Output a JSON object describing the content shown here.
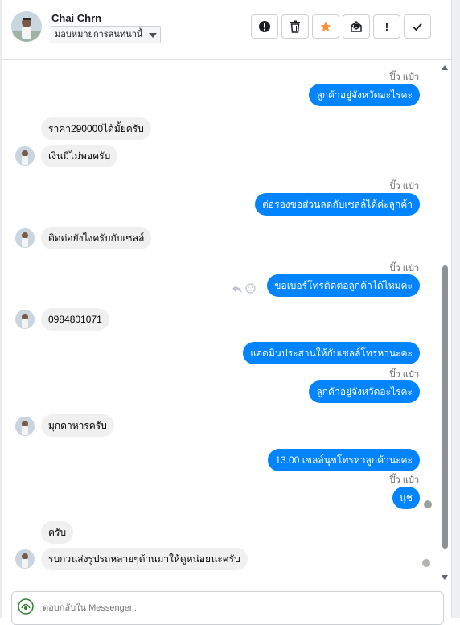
{
  "header": {
    "user_name": "Chai Chrn",
    "assign_label": "มอบหมายการสนทนานี้",
    "toolbar": {
      "exclamation_label": "!"
    }
  },
  "conversation": {
    "messages": [
      {
        "id": "m1",
        "direction": "out",
        "sender": "ปิ๊ว แป๋ว",
        "text": "ลูกค้าอยู่จังหวัดอะไรคะ"
      },
      {
        "id": "m2",
        "direction": "in",
        "text": "ราคา290000ได้มั้ยครับ"
      },
      {
        "id": "m3",
        "direction": "in",
        "text": "เงินมีไม่พอครับ"
      },
      {
        "id": "m4",
        "direction": "out",
        "sender": "ปิ๊ว แป๋ว",
        "text": "ต่อรองขอส่วนลดกับเซลล์ได้ค่ะลูกค้า"
      },
      {
        "id": "m5",
        "direction": "in",
        "text": "ติดต่อยังไงครับกับเซลล์"
      },
      {
        "id": "m6",
        "direction": "out",
        "sender": "ปิ๊ว แป๋ว",
        "text": "ขอเบอร์โทรติดต่อลูกค้าได้ไหมคะ"
      },
      {
        "id": "m7",
        "direction": "in",
        "text": "0984801071"
      },
      {
        "id": "m8",
        "direction": "out",
        "text": "แอดมินประสานให้กับเซลล์โทรหานะคะ"
      },
      {
        "id": "m9",
        "direction": "out",
        "sender": "ปิ๊ว แป๋ว",
        "text": "ลูกค้าอยู่จังหวัดอะไรคะ"
      },
      {
        "id": "m10",
        "direction": "in",
        "text": "มุกดาหารครับ"
      },
      {
        "id": "m11",
        "direction": "out",
        "text": "13.00  เซลล์นุชโทรหาลูกค้านะคะ"
      },
      {
        "id": "m12",
        "direction": "out",
        "sender": "ปิ๊ว แป๋ว",
        "text": "นุช"
      },
      {
        "id": "m13",
        "direction": "in",
        "text": "ครับ"
      },
      {
        "id": "m14",
        "direction": "in",
        "text": "รบกวนส่งรูปรถหลายๆด้านมาให้ดูหน่อยนะครับ"
      }
    ]
  },
  "composer": {
    "placeholder": "ตอบกลับใน Messenger..."
  },
  "colors": {
    "outgoing_bubble": "#0084ff",
    "incoming_bubble": "#f0f0f0",
    "star_accent": "#f7923a"
  },
  "icons": [
    "alert-circle-icon",
    "trash-icon",
    "star-icon",
    "mail-icon",
    "exclamation-icon",
    "checkmark-icon",
    "reply-icon",
    "emoji-icon"
  ]
}
